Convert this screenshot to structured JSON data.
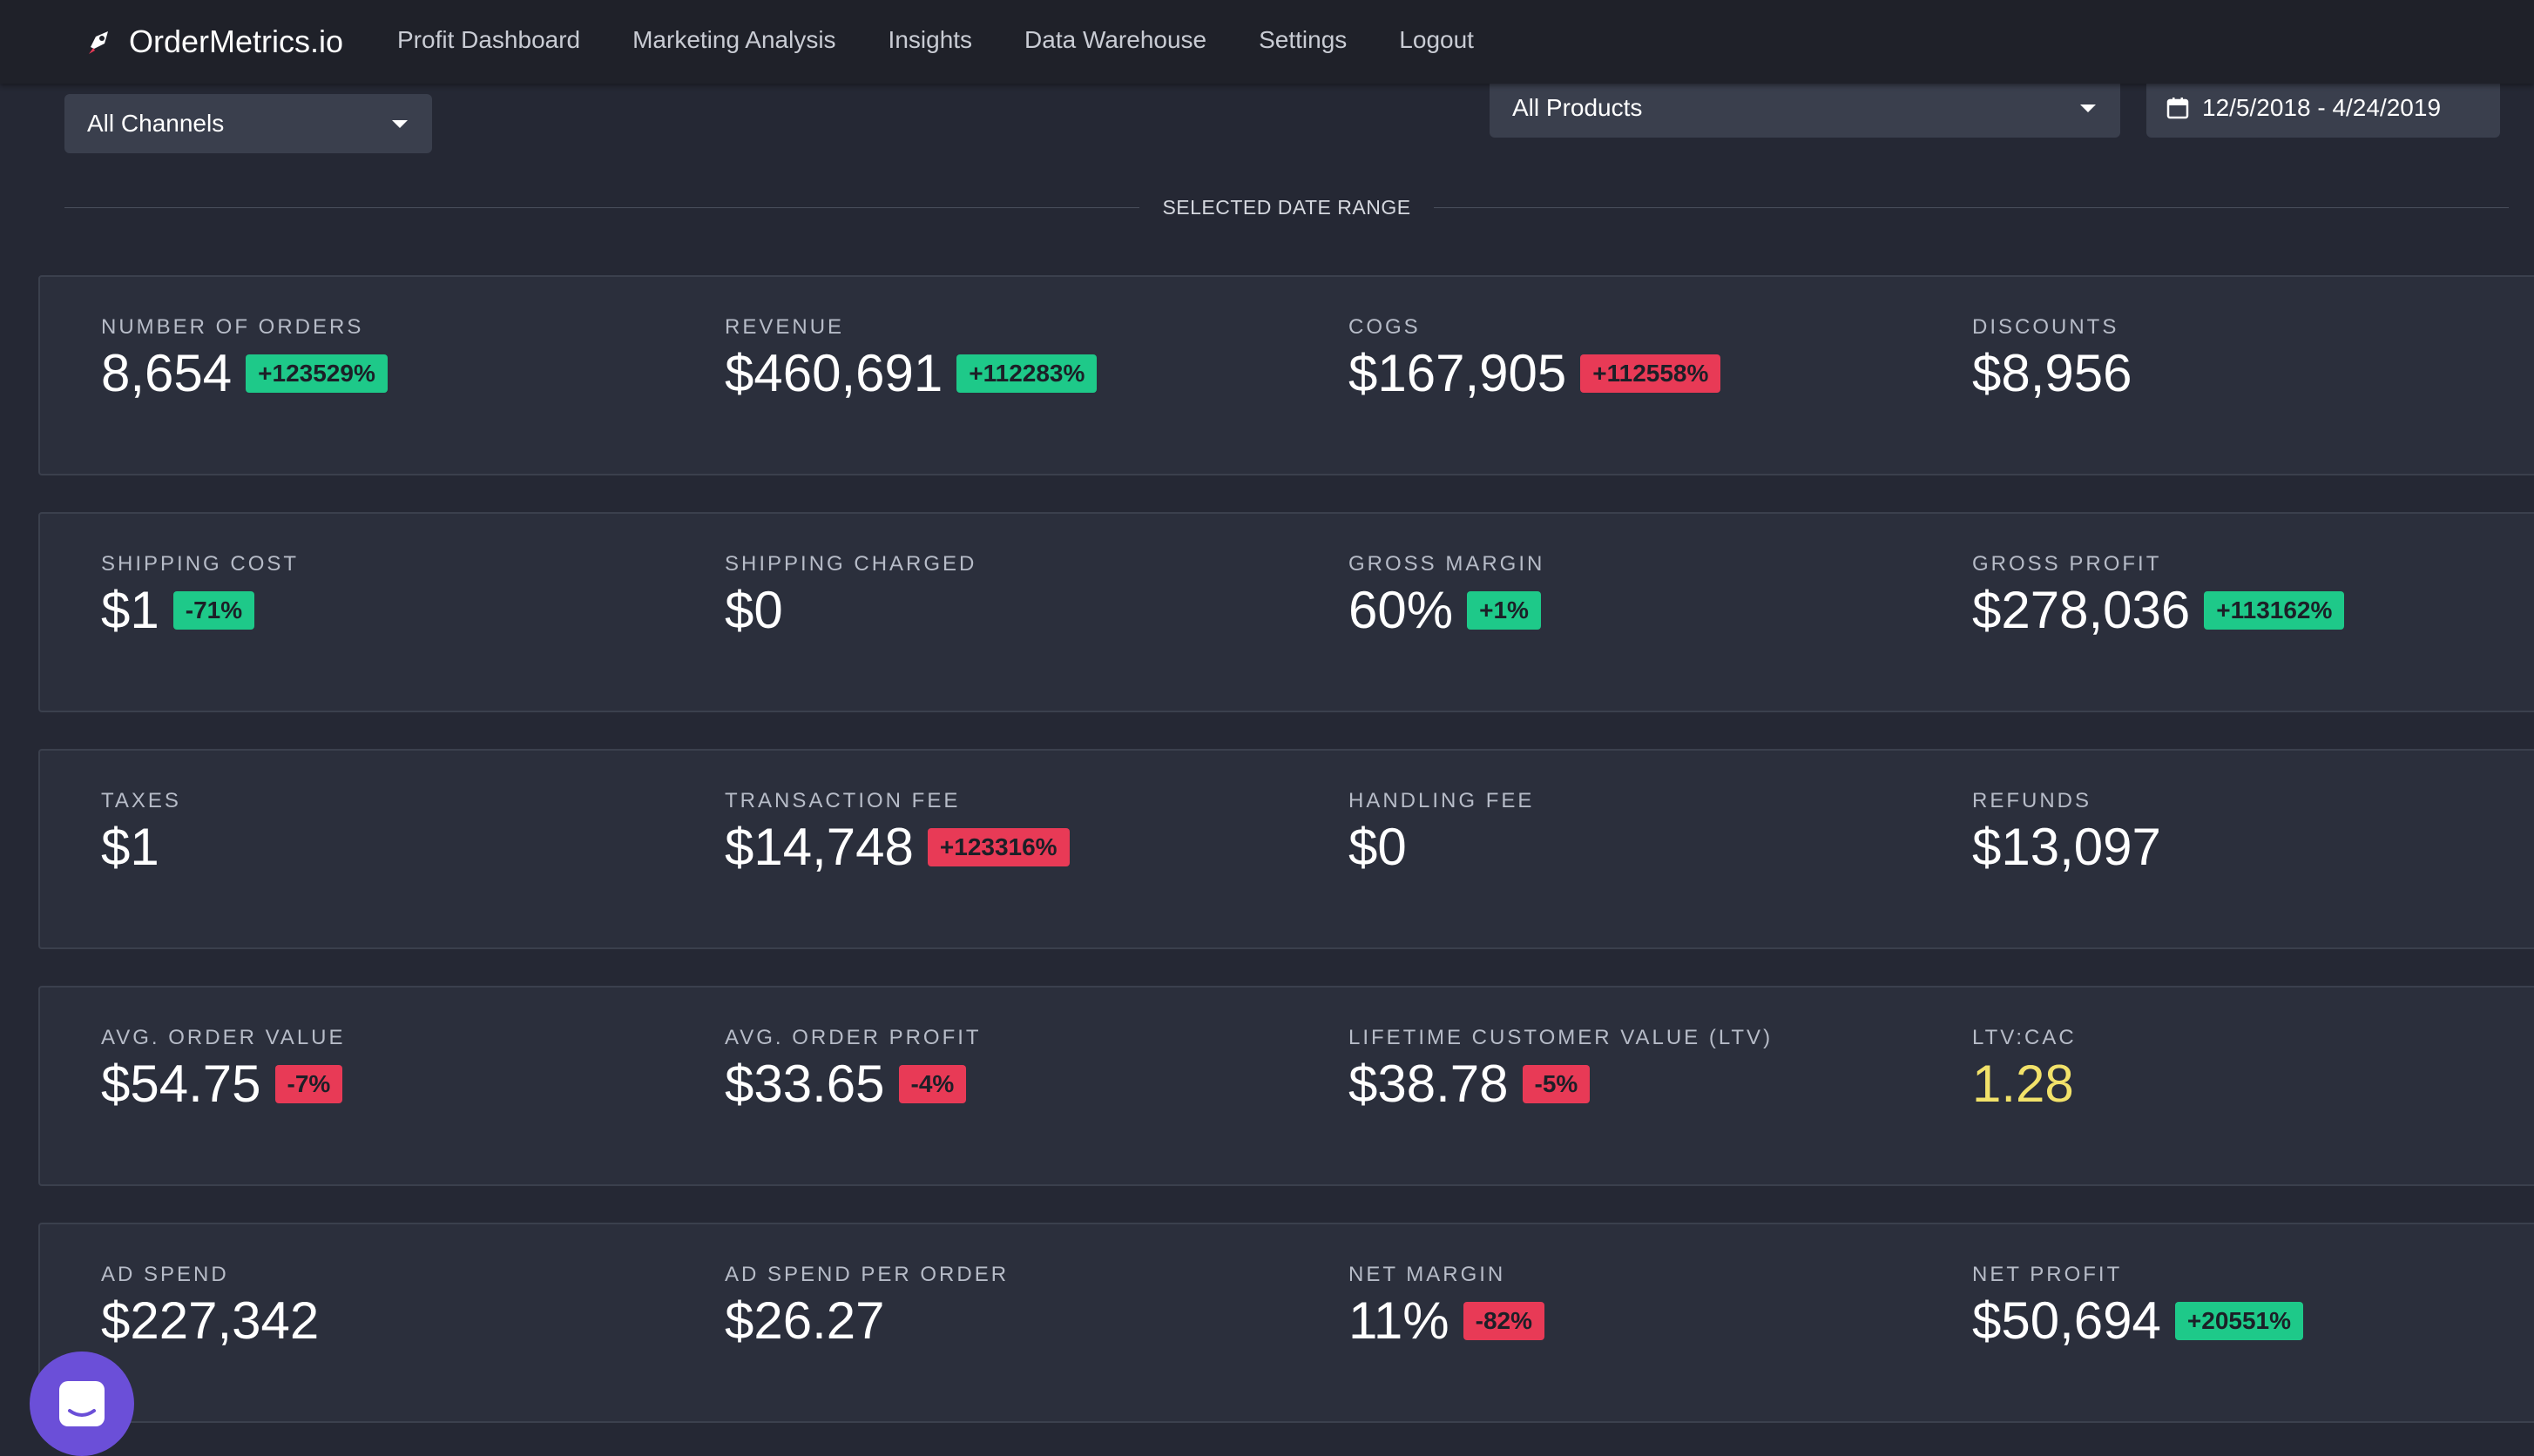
{
  "app": {
    "brand": "OrderMetrics.io",
    "nav": [
      "Profit Dashboard",
      "Marketing Analysis",
      "Insights",
      "Data Warehouse",
      "Settings",
      "Logout"
    ]
  },
  "filters": {
    "channels": "All Channels",
    "products": "All Products",
    "date_range": "12/5/2018 - 4/24/2019"
  },
  "section_label": "SELECTED DATE RANGE",
  "colors": {
    "positive": "#1ec989",
    "negative": "#e83a56",
    "highlight": "#f2e26a"
  },
  "cards": [
    {
      "metrics": [
        {
          "label": "NUMBER OF ORDERS",
          "value": "8,654",
          "change": "+123529%",
          "change_status": "positive"
        },
        {
          "label": "REVENUE",
          "value": "$460,691",
          "change": "+112283%",
          "change_status": "positive"
        },
        {
          "label": "COGS",
          "value": "$167,905",
          "change": "+112558%",
          "change_status": "negative"
        },
        {
          "label": "DISCOUNTS",
          "value": "$8,956"
        }
      ]
    },
    {
      "metrics": [
        {
          "label": "SHIPPING COST",
          "value": "$1",
          "change": "-71%",
          "change_status": "positive"
        },
        {
          "label": "SHIPPING CHARGED",
          "value": "$0"
        },
        {
          "label": "GROSS MARGIN",
          "value": "60%",
          "change": "+1%",
          "change_status": "positive"
        },
        {
          "label": "GROSS PROFIT",
          "value": "$278,036",
          "change": "+113162%",
          "change_status": "positive"
        }
      ]
    },
    {
      "metrics": [
        {
          "label": "TAXES",
          "value": "$1"
        },
        {
          "label": "TRANSACTION FEE",
          "value": "$14,748",
          "change": "+123316%",
          "change_status": "negative"
        },
        {
          "label": "HANDLING FEE",
          "value": "$0"
        },
        {
          "label": "REFUNDS",
          "value": "$13,097"
        }
      ]
    },
    {
      "metrics": [
        {
          "label": "AVG. ORDER VALUE",
          "value": "$54.75",
          "change": "-7%",
          "change_status": "negative"
        },
        {
          "label": "AVG. ORDER PROFIT",
          "value": "$33.65",
          "change": "-4%",
          "change_status": "negative"
        },
        {
          "label": "LIFETIME CUSTOMER VALUE (LTV)",
          "value": "$38.78",
          "change": "-5%",
          "change_status": "negative"
        },
        {
          "label": "LTV:CAC",
          "value": "1.28",
          "value_highlight": true
        }
      ]
    },
    {
      "metrics": [
        {
          "label": "AD SPEND",
          "value": "$227,342"
        },
        {
          "label": "AD SPEND PER ORDER",
          "value": "$26.27"
        },
        {
          "label": "NET MARGIN",
          "value": "11%",
          "change": "-82%",
          "change_status": "negative"
        },
        {
          "label": "NET PROFIT",
          "value": "$50,694",
          "change": "+20551%",
          "change_status": "positive"
        }
      ]
    }
  ]
}
